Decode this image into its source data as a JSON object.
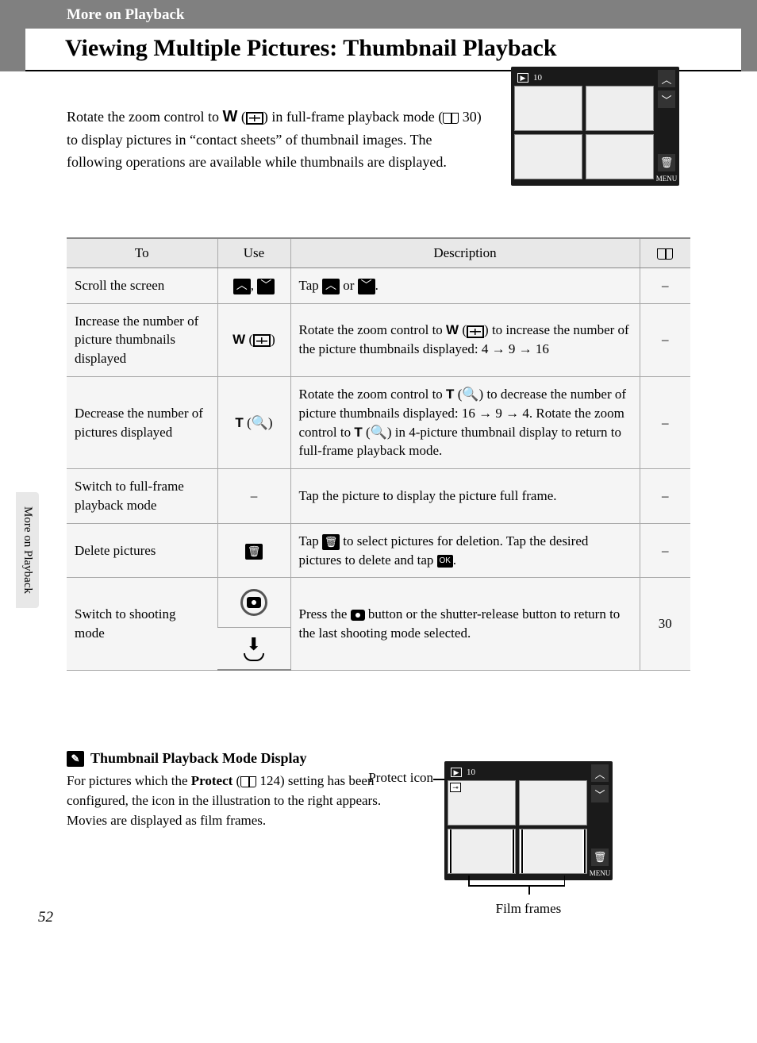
{
  "header": {
    "section": "More on Playback",
    "title": "Viewing Multiple Pictures: Thumbnail Playback"
  },
  "intro": {
    "p1a": "Rotate the zoom control to ",
    "W": "W",
    "p1b": " in full-frame playback mode (",
    "ref": "30",
    "p1c": ") to display pictures in “contact sheets” of thumbnail images. The following operations are available while thumbnails are displayed."
  },
  "screen1": {
    "counter": "10"
  },
  "table": {
    "headers": {
      "to": "To",
      "use": "Use",
      "desc": "Description"
    },
    "rows": {
      "scroll": {
        "to": "Scroll the screen",
        "desc_a": "Tap ",
        "desc_b": " or ",
        "desc_c": ".",
        "ref": "–"
      },
      "increase": {
        "to": "Increase the number of picture thumbnails displayed",
        "use": "W",
        "desc_a": "Rotate the zoom control to ",
        "W": "W",
        "desc_b": " to increase the number of the picture thumbnails displayed: 4 → 9 → 16",
        "ref": "–"
      },
      "decrease": {
        "to": "Decrease the number of pictures displayed",
        "use": "T",
        "desc_a": "Rotate the zoom control to ",
        "T1": "T",
        "desc_b": " to decrease the number of picture thumbnails displayed: 16 → 9 → 4. Rotate the zoom control to ",
        "T2": "T",
        "desc_c": " in 4-picture thumbnail display to return to full-frame playback mode.",
        "ref": "–"
      },
      "fullframe": {
        "to": "Switch to full-frame playback mode",
        "use": "–",
        "desc": "Tap the picture to display the picture full frame.",
        "ref": "–"
      },
      "delete": {
        "to": "Delete pictures",
        "desc_a": "Tap ",
        "desc_b": " to select pictures for deletion. Tap the desired pictures to delete and tap ",
        "desc_c": ".",
        "ref": "–"
      },
      "shoot": {
        "to": "Switch to shooting mode",
        "desc_a": "Press the ",
        "desc_b": " button or the shutter-release button to return to the last shooting mode selected.",
        "ref": "30"
      }
    }
  },
  "note": {
    "title": "Thumbnail Playback Mode Display",
    "l1a": "For pictures which the ",
    "protect": "Protect",
    "l1b": " (",
    "ref": "124",
    "l1c": ") setting has been configured, the icon in the illustration to the right appears.",
    "l2": "Movies are displayed as film frames.",
    "protect_label": "Protect icon",
    "film_label": "Film frames"
  },
  "screen2": {
    "counter": "10"
  },
  "sidetab": "More on Playback",
  "page": "52"
}
